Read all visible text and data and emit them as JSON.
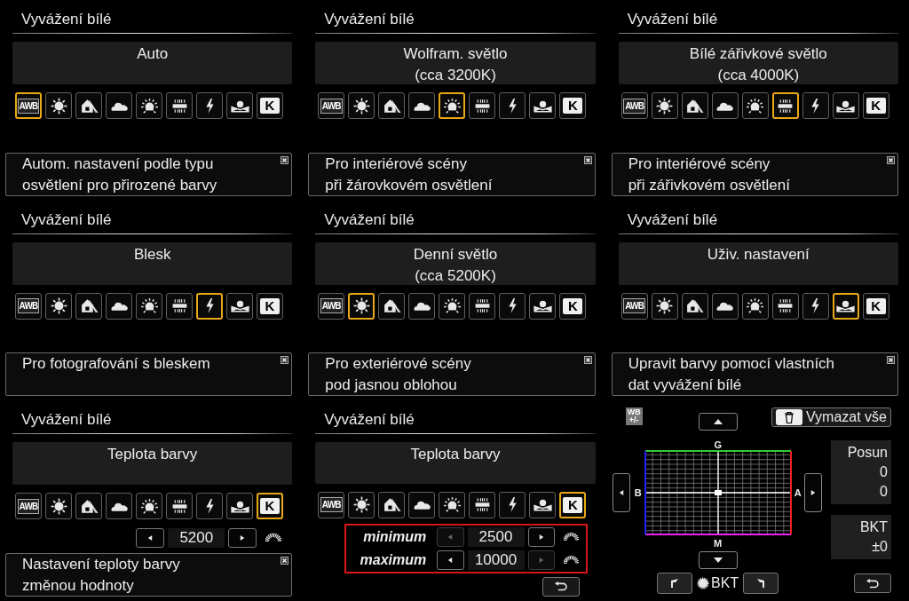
{
  "screens": [
    {
      "kind": "wb_select",
      "title": "Vyvážení bílé",
      "mode_name": [
        "Auto"
      ],
      "modes": [
        {
          "kind": "awb",
          "label": "AWB",
          "selected": true
        },
        {
          "kind": "daylight",
          "selected": false
        },
        {
          "kind": "shade",
          "selected": false
        },
        {
          "kind": "cloudy",
          "selected": false
        },
        {
          "kind": "tungsten",
          "selected": false
        },
        {
          "kind": "fluorescent",
          "selected": false
        },
        {
          "kind": "flash",
          "selected": false
        },
        {
          "kind": "custom",
          "selected": false
        },
        {
          "kind": "kelvin",
          "label": "K",
          "selected": false
        }
      ],
      "help": [
        "Autom. nastavení podle typu",
        "osvětlení pro přirozené barvy"
      ]
    },
    {
      "kind": "wb_select",
      "title": "Vyvážení bílé",
      "mode_name": [
        "Wolfram. světlo",
        "(cca 3200K)"
      ],
      "modes": [
        {
          "kind": "awb",
          "label": "AWB",
          "selected": false
        },
        {
          "kind": "daylight",
          "selected": false
        },
        {
          "kind": "shade",
          "selected": false
        },
        {
          "kind": "cloudy",
          "selected": false
        },
        {
          "kind": "tungsten",
          "selected": true
        },
        {
          "kind": "fluorescent",
          "selected": false
        },
        {
          "kind": "flash",
          "selected": false
        },
        {
          "kind": "custom",
          "selected": false
        },
        {
          "kind": "kelvin",
          "label": "K",
          "selected": false
        }
      ],
      "help": [
        "Pro interiérové scény",
        "při žárovkovém osvětlení"
      ]
    },
    {
      "kind": "wb_select",
      "title": "Vyvážení bílé",
      "mode_name": [
        "Bílé zářivkové světlo",
        "(cca 4000K)"
      ],
      "modes": [
        {
          "kind": "awb",
          "label": "AWB",
          "selected": false
        },
        {
          "kind": "daylight",
          "selected": false
        },
        {
          "kind": "shade",
          "selected": false
        },
        {
          "kind": "cloudy",
          "selected": false
        },
        {
          "kind": "tungsten",
          "selected": false
        },
        {
          "kind": "fluorescent",
          "selected": true
        },
        {
          "kind": "flash",
          "selected": false
        },
        {
          "kind": "custom",
          "selected": false
        },
        {
          "kind": "kelvin",
          "label": "K",
          "selected": false
        }
      ],
      "help": [
        "Pro interiérové scény",
        "při zářivkovém osvětlení"
      ]
    },
    {
      "kind": "wb_select",
      "title": "Vyvážení bílé",
      "mode_name": [
        "Blesk"
      ],
      "modes": [
        {
          "kind": "awb",
          "label": "AWB",
          "selected": false
        },
        {
          "kind": "daylight",
          "selected": false
        },
        {
          "kind": "shade",
          "selected": false
        },
        {
          "kind": "cloudy",
          "selected": false
        },
        {
          "kind": "tungsten",
          "selected": false
        },
        {
          "kind": "fluorescent",
          "selected": false
        },
        {
          "kind": "flash",
          "selected": true
        },
        {
          "kind": "custom",
          "selected": false
        },
        {
          "kind": "kelvin",
          "label": "K",
          "selected": false
        }
      ],
      "help": [
        "Pro fotografování s bleskem"
      ]
    },
    {
      "kind": "wb_select",
      "title": "Vyvážení bílé",
      "mode_name": [
        "Denní světlo",
        "(cca 5200K)"
      ],
      "modes": [
        {
          "kind": "awb",
          "label": "AWB",
          "selected": false
        },
        {
          "kind": "daylight",
          "selected": true
        },
        {
          "kind": "shade",
          "selected": false
        },
        {
          "kind": "cloudy",
          "selected": false
        },
        {
          "kind": "tungsten",
          "selected": false
        },
        {
          "kind": "fluorescent",
          "selected": false
        },
        {
          "kind": "flash",
          "selected": false
        },
        {
          "kind": "custom",
          "selected": false
        },
        {
          "kind": "kelvin",
          "label": "K",
          "selected": false
        }
      ],
      "help": [
        "Pro exteriérové scény",
        "pod jasnou oblohou"
      ]
    },
    {
      "kind": "wb_select",
      "title": "Vyvážení bílé",
      "mode_name": [
        "Uživ. nastavení"
      ],
      "modes": [
        {
          "kind": "awb",
          "label": "AWB",
          "selected": false
        },
        {
          "kind": "daylight",
          "selected": false
        },
        {
          "kind": "shade",
          "selected": false
        },
        {
          "kind": "cloudy",
          "selected": false
        },
        {
          "kind": "tungsten",
          "selected": false
        },
        {
          "kind": "fluorescent",
          "selected": false
        },
        {
          "kind": "flash",
          "selected": false
        },
        {
          "kind": "custom",
          "selected": true
        },
        {
          "kind": "kelvin",
          "label": "K",
          "selected": false
        }
      ],
      "help": [
        "Upravit barvy pomocí vlastních",
        "dat vyvážení bílé"
      ]
    },
    {
      "kind": "wb_select",
      "title": "Vyvážení bílé",
      "mode_name": [
        "Teplota barvy"
      ],
      "modes": [
        {
          "kind": "awb",
          "label": "AWB",
          "selected": false
        },
        {
          "kind": "daylight",
          "selected": false
        },
        {
          "kind": "shade",
          "selected": false
        },
        {
          "kind": "cloudy",
          "selected": false
        },
        {
          "kind": "tungsten",
          "selected": false
        },
        {
          "kind": "fluorescent",
          "selected": false
        },
        {
          "kind": "flash",
          "selected": false
        },
        {
          "kind": "custom",
          "selected": false
        },
        {
          "kind": "kelvin",
          "label": "K",
          "selected": true
        }
      ],
      "kelvin_value": "5200",
      "help": [
        "Nastavení teploty barvy",
        "změnou hodnoty"
      ]
    },
    {
      "kind": "wb_select",
      "title": "Vyvážení bílé",
      "mode_name": [
        "Teplota barvy"
      ],
      "modes": [
        {
          "kind": "awb",
          "label": "AWB",
          "selected": false
        },
        {
          "kind": "daylight",
          "selected": false
        },
        {
          "kind": "shade",
          "selected": false
        },
        {
          "kind": "cloudy",
          "selected": false
        },
        {
          "kind": "tungsten",
          "selected": false
        },
        {
          "kind": "fluorescent",
          "selected": false
        },
        {
          "kind": "flash",
          "selected": false
        },
        {
          "kind": "custom",
          "selected": false
        },
        {
          "kind": "kelvin",
          "label": "K",
          "selected": true
        }
      ],
      "range": [
        {
          "label": "minimum",
          "value": "2500",
          "left_disabled": true,
          "right_disabled": false
        },
        {
          "label": "maximum",
          "value": "10000",
          "left_disabled": false,
          "right_disabled": true
        }
      ],
      "back_button": true
    },
    {
      "kind": "wb_shift",
      "badge": [
        "WB",
        "+/-"
      ],
      "clear_button": "Vymazat vše",
      "axis": {
        "top": "G",
        "left": "B",
        "right": "A",
        "bottom": "M"
      },
      "shift": {
        "title": "Posun",
        "values": [
          "0",
          "0"
        ]
      },
      "bkt": {
        "title": "BKT",
        "value": "±0"
      },
      "dial_label": "BKT",
      "back_button": true
    }
  ]
}
